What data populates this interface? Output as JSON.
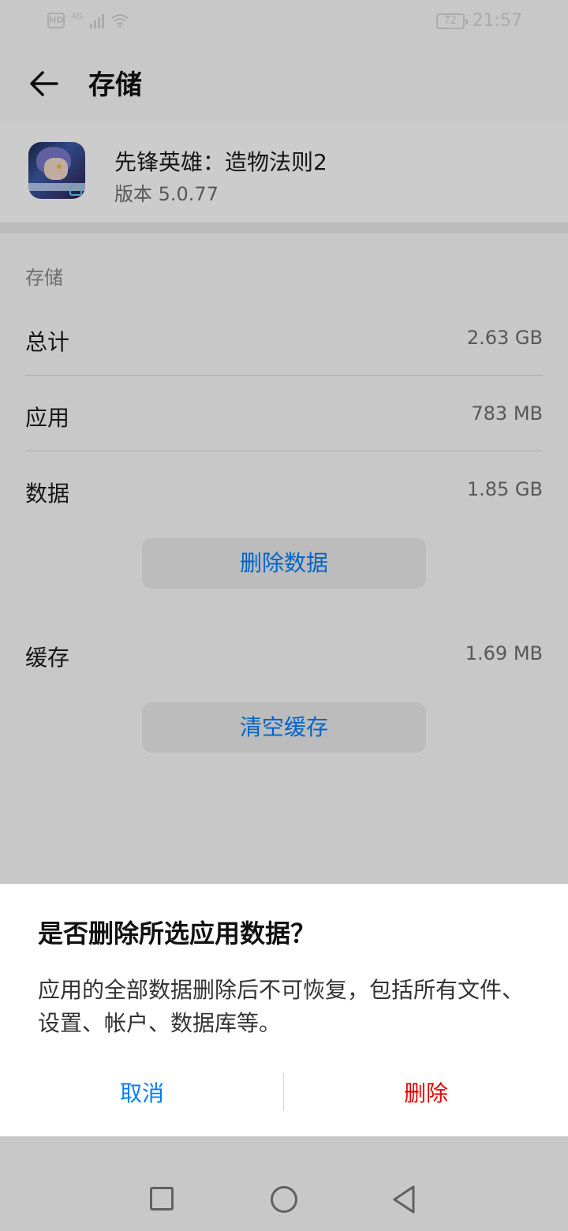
{
  "status_bar": {
    "hd": "HD",
    "network": "4G",
    "battery": "72",
    "time": "21:57"
  },
  "header": {
    "back_icon": "arrow-left-icon",
    "title": "存储"
  },
  "app": {
    "name": "先锋英雄：造物法则2",
    "version": "版本 5.0.77"
  },
  "storage": {
    "section_title": "存储",
    "rows": [
      {
        "label": "总计",
        "value": "2.63 GB"
      },
      {
        "label": "应用",
        "value": "783 MB"
      },
      {
        "label": "数据",
        "value": "1.85 GB"
      },
      {
        "label": "缓存",
        "value": "1.69 MB"
      }
    ],
    "delete_data_button": "删除数据",
    "clear_cache_button": "清空缓存"
  },
  "dialog": {
    "title": "是否删除所选应用数据？",
    "message": "应用的全部数据删除后不可恢复，包括所有文件、设置、帐户、数据库等。",
    "cancel": "取消",
    "delete": "删除"
  },
  "colors": {
    "accent": "#007dff",
    "danger": "#e60000"
  },
  "navbar": {
    "icons": [
      "recents-square-icon",
      "home-circle-icon",
      "back-triangle-icon"
    ]
  }
}
